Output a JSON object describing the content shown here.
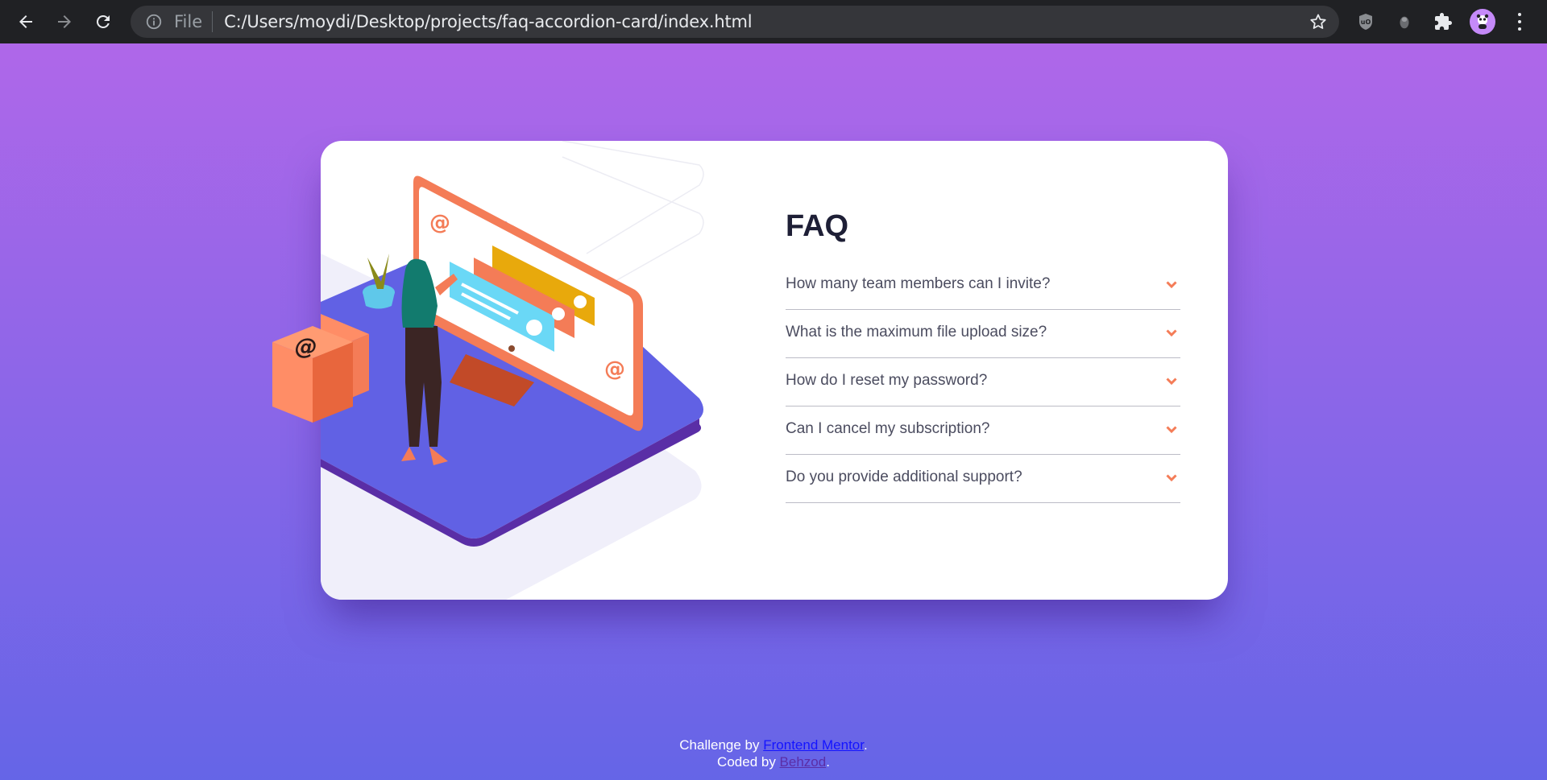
{
  "browser": {
    "file_label": "File",
    "url": "C:/Users/moydi/Desktop/projects/faq-accordion-card/index.html",
    "icons": [
      "back-arrow-icon",
      "forward-arrow-icon",
      "reload-icon",
      "info-icon",
      "star-icon",
      "ublock-icon",
      "extension-icon",
      "puzzle-icon",
      "profile-avatar",
      "more-menu-icon"
    ]
  },
  "faq": {
    "title": "FAQ",
    "items": [
      {
        "question": "How many team members can I invite?"
      },
      {
        "question": "What is the maximum file upload size?"
      },
      {
        "question": "How do I reset my password?"
      },
      {
        "question": "Can I cancel my subscription?"
      },
      {
        "question": "Do you provide additional support?"
      }
    ]
  },
  "footer": {
    "challenge_prefix": "Challenge by ",
    "challenge_link": "Frontend Mentor",
    "challenge_suffix": ".",
    "coded_prefix": "Coded by ",
    "coded_link": "Behzod",
    "coded_suffix": "."
  },
  "colors": {
    "gradient_top": "#af67e9",
    "gradient_bottom": "#6565e7",
    "accent": "#f47c57",
    "heading": "#1e1f36",
    "question_text": "#4b4c5f"
  }
}
